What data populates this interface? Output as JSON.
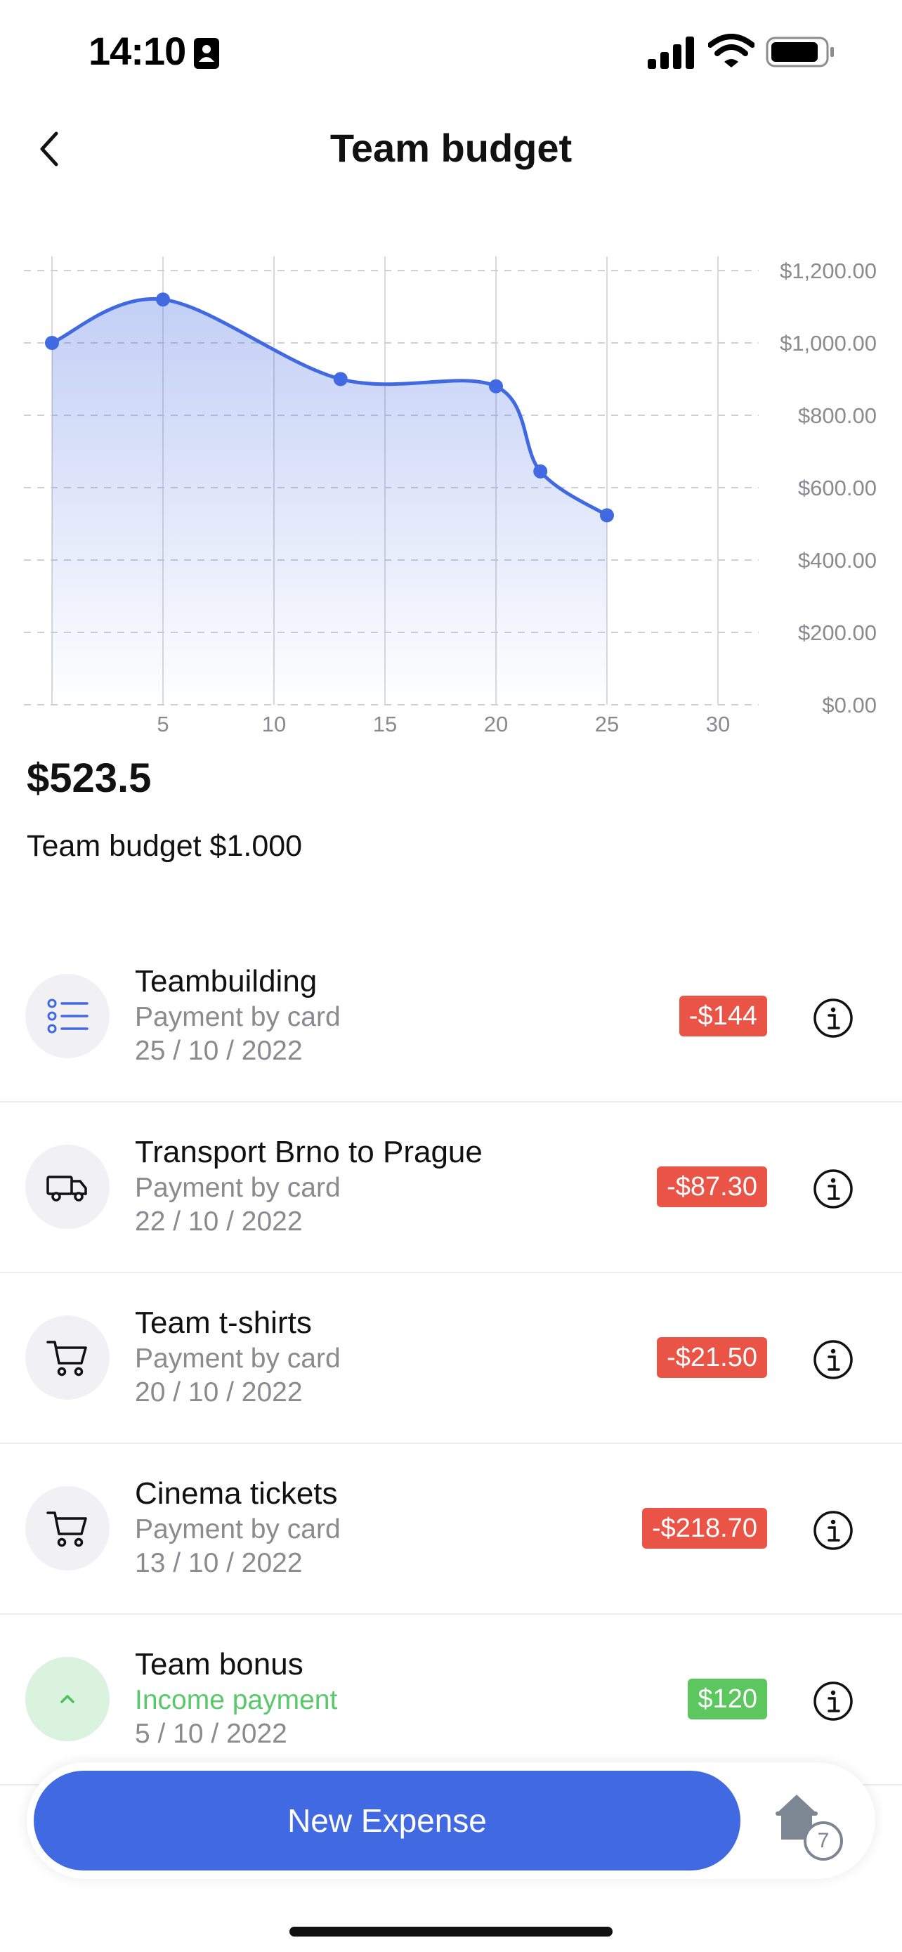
{
  "status_bar": {
    "time": "14:10",
    "icons": [
      "person-badge-icon",
      "cellular-signal-icon",
      "wifi-icon",
      "battery-icon"
    ]
  },
  "nav": {
    "back_icon": "chevron-left-icon",
    "title": "Team budget"
  },
  "chart_data": {
    "type": "area",
    "x": [
      0,
      5,
      13,
      20,
      22,
      25
    ],
    "y": [
      1000,
      1120,
      900,
      880,
      645,
      523.5
    ],
    "xlim": [
      0,
      30
    ],
    "ylim": [
      0,
      1200
    ],
    "x_ticks": [
      "5",
      "10",
      "15",
      "20",
      "25",
      "30"
    ],
    "y_ticks": [
      "$1,200.00",
      "$1,000.00",
      "$800.00",
      "$600.00",
      "$400.00",
      "$200.00",
      "$0.00"
    ],
    "axis_position_y": "right",
    "grid": true,
    "color": "#4169e1",
    "title": "",
    "xlabel": "",
    "ylabel": ""
  },
  "summary": {
    "balance": "$523.5",
    "budget_label": "Team budget $1.000"
  },
  "transactions": [
    {
      "title": "Teambuilding",
      "method": "Payment by card",
      "date": "25 / 10 / 2022",
      "amount": "-$144",
      "type": "expense",
      "icon": "list-icon"
    },
    {
      "title": "Transport Brno to Prague",
      "method": "Payment by card",
      "date": "22 / 10 / 2022",
      "amount": "-$87.30",
      "type": "expense",
      "icon": "truck-icon"
    },
    {
      "title": "Team t-shirts",
      "method": "Payment by card",
      "date": "20 / 10 / 2022",
      "amount": "-$21.50",
      "type": "expense",
      "icon": "cart-icon"
    },
    {
      "title": "Cinema tickets",
      "method": "Payment by card",
      "date": "13 / 10 / 2022",
      "amount": "-$218.70",
      "type": "expense",
      "icon": "cart-icon"
    },
    {
      "title": "Team bonus",
      "method": "Income payment",
      "date": "5 / 10 / 2022",
      "amount": "$120",
      "type": "income",
      "icon": "chevron-up-icon"
    }
  ],
  "colors": {
    "accent": "#4169e1",
    "expense": "#ea5446",
    "income": "#5cc65f"
  },
  "bottom_bar": {
    "button_label": "New Expense",
    "home_badge": "7"
  }
}
